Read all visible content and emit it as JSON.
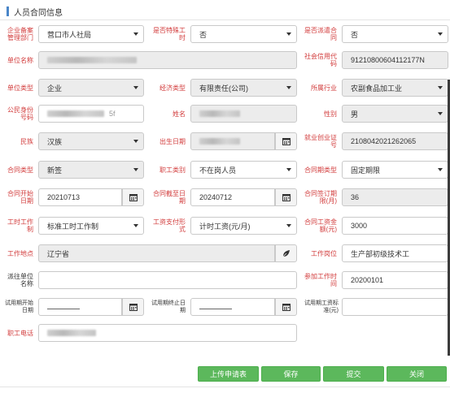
{
  "section": {
    "title": "人员合同信息"
  },
  "labels": {
    "record_dept": "企业备案管理部门",
    "special_work": "是否特殊工时",
    "dispatched": "是否派遣合同",
    "company_name": "单位名称",
    "credit_code": "社会信用代码",
    "company_type": "单位类型",
    "econ_type": "经济类型",
    "industry": "所属行业",
    "id_number": "公民身份号码",
    "name": "姓名",
    "gender": "性别",
    "ethnicity": "民族",
    "birth_date": "出生日期",
    "employment_cert": "就业创业证号",
    "contract_type": "合同类型",
    "worker_type": "职工类别",
    "term_type": "合同期类型",
    "start_date": "合同开始日期",
    "end_date": "合同截至日期",
    "term_months": "合同签订期限(月)",
    "work_hours": "工时工作制",
    "pay_form": "工资支付形式",
    "wage": "合同工资金额(元)",
    "location": "工作地点",
    "position": "工作岗位",
    "dispatch_unit": "派往单位名称",
    "work_start": "参加工作时间",
    "trial_start": "试用期开始日期",
    "trial_end": "试用期终止日期",
    "trial_wage": "试用期工资标准(元)",
    "phone": "职工电话"
  },
  "values": {
    "record_dept": "营口市人社局",
    "special_work": "否",
    "dispatched": "否",
    "credit_code": "91210800604112177N",
    "company_type": "企业",
    "econ_type": "有限责任(公司)",
    "industry": "农副食品加工业",
    "id_suffix": "5f",
    "gender": "男",
    "ethnicity": "汉族",
    "employment_cert": "2108042021262065",
    "contract_type": "新签",
    "worker_type": "不在岗人员",
    "term_type": "固定期限",
    "start_date": "20210713",
    "end_date": "20240712",
    "term_months": "36",
    "work_hours": "标准工时工作制",
    "pay_form": "计时工资(元/月)",
    "wage": "3000",
    "location": "辽宁省",
    "position": "生产部初级技术工",
    "dispatch_unit": "",
    "work_start": "20200101",
    "trial_wage": ""
  },
  "buttons": {
    "upload": "上传申请表",
    "save": "保存",
    "submit": "提交",
    "close": "关闭"
  },
  "icons": {
    "select": "caret-down-icon",
    "calendar": "calendar-icon",
    "location": "leaf-icon"
  },
  "colors": {
    "required_label": "#d23b3b",
    "button_green": "#5cb85c",
    "readonly_bg": "#ececec",
    "section_bar": "#4a86c8"
  }
}
